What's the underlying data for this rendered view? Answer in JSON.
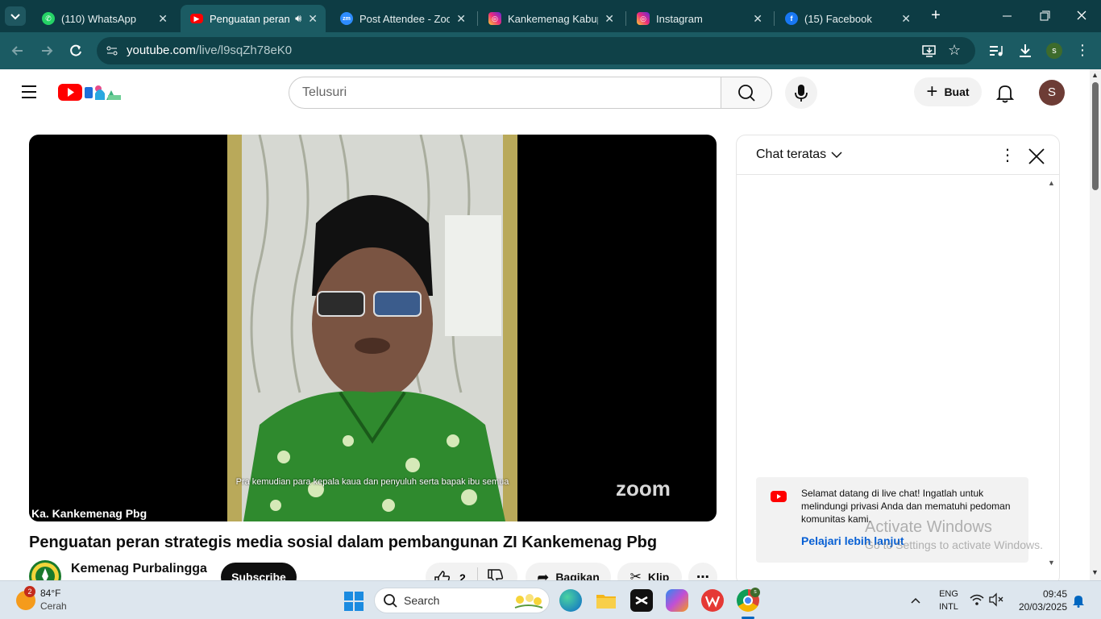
{
  "browser": {
    "tabs": [
      {
        "label": "(110) WhatsApp",
        "icon": "whatsapp-icon",
        "active": false
      },
      {
        "label": "Penguatan peran",
        "icon": "youtube-icon",
        "active": true
      },
      {
        "label": "Post Attendee - Zoom",
        "icon": "zoom-icon",
        "active": false
      },
      {
        "label": "Kankemenag Kabupa",
        "icon": "instagram-icon",
        "active": false
      },
      {
        "label": "Instagram",
        "icon": "instagram-icon",
        "active": false
      },
      {
        "label": "(15) Facebook",
        "icon": "facebook-icon",
        "active": false
      }
    ],
    "url_domain": "youtube.com",
    "url_path": "/live/l9sqZh78eK0",
    "profile_initial": "s"
  },
  "youtube": {
    "search_placeholder": "Telusuri",
    "create_label": "Buat",
    "avatar_initial": "S"
  },
  "video": {
    "caption": "Pra kemudian para kepala kaua dan penyuluh serta bapak ibu semua",
    "speaker_name": "Ka. Kankemenag Pbg",
    "zoom_watermark": "zoom",
    "title": "Penguatan peran strategis media sosial dalam pembangunan ZI Kankemenag Pbg",
    "channel_name": "Kemenag Purbalingga",
    "subscribe_label": "Subscribe",
    "like_count": "2",
    "share_label": "Bagikan",
    "clip_label": "Klip"
  },
  "chat": {
    "header_title": "Chat teratas",
    "welcome_message": "Selamat datang di live chat! Ingatlah untuk melindungi privasi Anda dan mematuhi pedoman komunitas kami.",
    "learn_more": "Pelajari lebih lanjut"
  },
  "watermark": {
    "title": "Activate Windows",
    "subtitle": "Go to Settings to activate Windows."
  },
  "taskbar": {
    "weather_badge": "2",
    "temperature": "84°F",
    "weather_condition": "Cerah",
    "search_placeholder": "Search",
    "language": "ENG",
    "layout": "INTL",
    "time": "09:45",
    "date": "20/03/2025"
  },
  "colors": {
    "chrome_dark": "#0d3c44",
    "chrome_mid": "#1b5b63",
    "youtube_red": "#ff0000",
    "link_blue": "#065fd4"
  }
}
